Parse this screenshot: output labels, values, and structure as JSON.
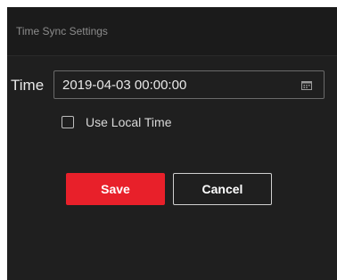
{
  "dialog": {
    "title": "Time Sync Settings"
  },
  "time": {
    "label": "Time",
    "value": "2019-04-03 00:00:00"
  },
  "use_local_time": {
    "label": "Use Local Time",
    "checked": false
  },
  "buttons": {
    "save_label": "Save",
    "cancel_label": "Cancel"
  },
  "icons": {
    "calendar": "calendar-icon"
  },
  "colors": {
    "background": "#1f1f1f",
    "accent": "#e8202a",
    "text": "#e8e8e8"
  }
}
